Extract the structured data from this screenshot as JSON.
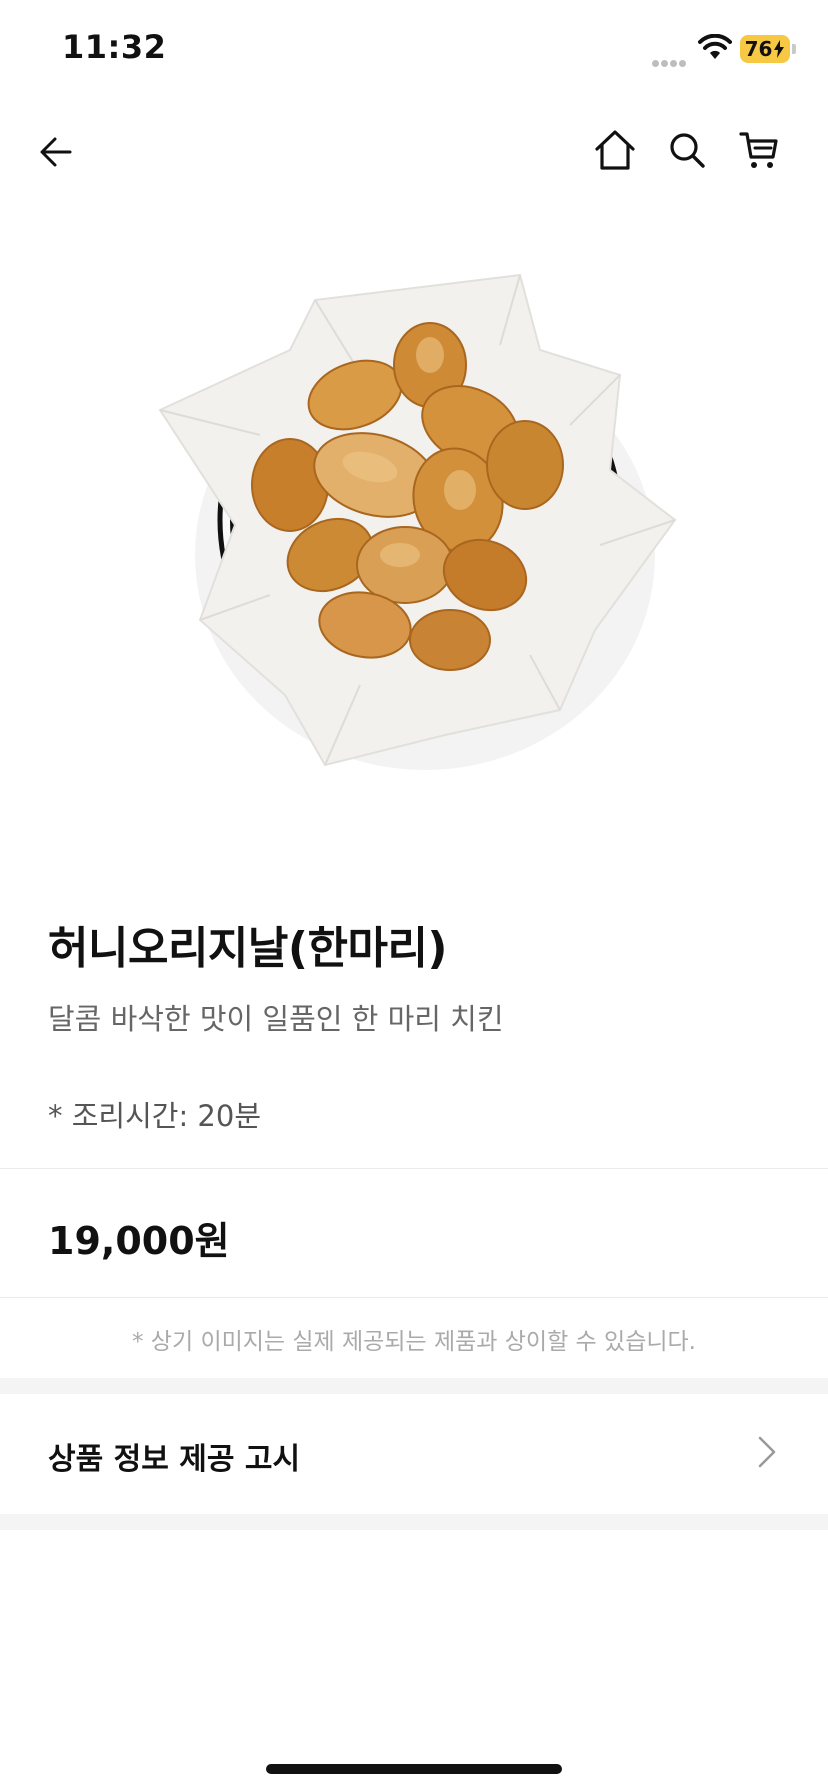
{
  "status_bar": {
    "time": "11:32",
    "battery": "76",
    "icons": [
      "signal-dots-icon",
      "wifi-icon",
      "battery-charging-icon"
    ]
  },
  "nav": {
    "icons": [
      "back-arrow-icon",
      "home-icon",
      "search-icon",
      "cart-icon"
    ]
  },
  "product": {
    "image_alt": "fried chicken basket",
    "title": "허니오리지날(한마리)",
    "description": "달콤 바삭한 맛이 일품인 한 마리 치킨",
    "cook_time": "* 조리시간: 20분",
    "price": "19,000원",
    "image_notice": "* 상기 이미지는 실제 제공되는 제품과 상이할 수 있습니다."
  },
  "info_row": {
    "label": "상품 정보 제공 고시",
    "icon": "chevron-right-icon"
  },
  "colors": {
    "battery": "#f6c844",
    "text_primary": "#111111",
    "text_secondary": "#666666",
    "notice": "#aaaaaa",
    "band": "#f4f4f4"
  }
}
